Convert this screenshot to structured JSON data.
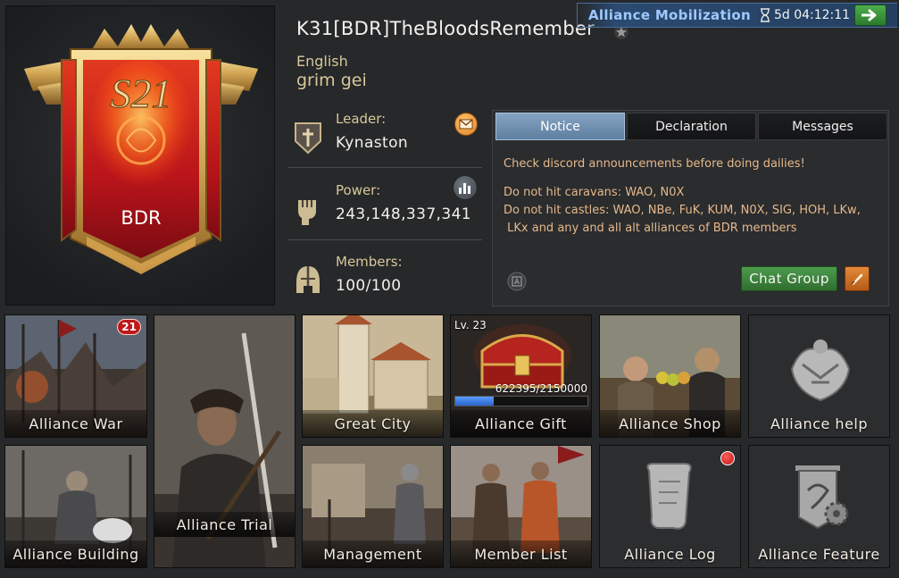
{
  "header": {
    "alliance_name": "K31[BDR]TheBloodsRemember",
    "language": "English",
    "tagline": "grim gei"
  },
  "banner": {
    "season_label": "S21",
    "tag": "BDR"
  },
  "mobilization": {
    "label": "Alliance Mobilization",
    "timer": "5d 04:12:11"
  },
  "info": {
    "leader_label": "Leader:",
    "leader_value": "Kynaston",
    "power_label": "Power:",
    "power_value": "243,148,337,341",
    "members_label": "Members:",
    "members_value": "100/100"
  },
  "notice": {
    "tabs": [
      "Notice",
      "Declaration",
      "Messages"
    ],
    "active_tab": "Notice",
    "lines": [
      "Check discord announcements before doing dailies!",
      "Do not hit caravans: WAO, N0X",
      "Do not hit castles: WAO, NBe, FuK, KUM, N0X, SIG, HOH, LKw,",
      " LKx and any and all alt alliances of BDR members"
    ],
    "chat_group_label": "Chat Group"
  },
  "tiles": {
    "alliance_war": {
      "label": "Alliance War",
      "badge": "21"
    },
    "alliance_trial": {
      "label": "Alliance Trial"
    },
    "great_city": {
      "label": "Great City"
    },
    "alliance_gift": {
      "label": "Alliance Gift",
      "level": "Lv. 23",
      "progress_text": "622395/2150000",
      "progress_fraction": 0.2895
    },
    "alliance_shop": {
      "label": "Alliance Shop"
    },
    "alliance_help": {
      "label": "Alliance help"
    },
    "alliance_building": {
      "label": "Alliance Building"
    },
    "management": {
      "label": "Management"
    },
    "member_list": {
      "label": "Member List"
    },
    "alliance_log": {
      "label": "Alliance Log"
    },
    "alliance_feature": {
      "label": "Alliance Feature"
    }
  },
  "colors": {
    "accent_gold": "#d8c79a",
    "notice_text": "#e6b88a",
    "tab_active": "#6f8fb0",
    "button_green": "#3f8a3f",
    "badge_red": "#c0181c"
  }
}
